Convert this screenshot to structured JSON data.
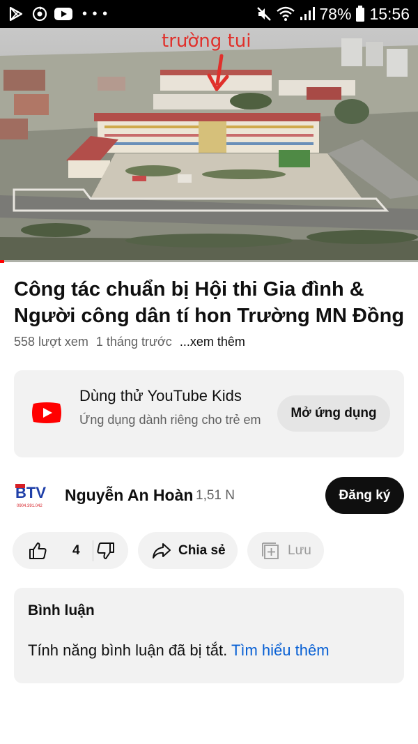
{
  "status_bar": {
    "battery": "78%",
    "time": "15:56",
    "left_icons": [
      "play-store-icon",
      "sync-icon",
      "youtube-icon",
      "more-dots-icon"
    ],
    "right_icons": [
      "mute-icon",
      "wifi-icon",
      "signal-icon",
      "battery-icon"
    ]
  },
  "video": {
    "overlay_text": "trường tui",
    "progress": 0.01
  },
  "title": {
    "line1": "Công tác chuẩn bị Hội thi Gia đình &",
    "line2": "Người công dân tí hon Trường MN Đồng ..."
  },
  "meta": {
    "views": "558 lượt xem",
    "age": "1 tháng trước",
    "more": "...xem thêm"
  },
  "kids_promo": {
    "title": "Dùng thử YouTube Kids",
    "subtitle": "Ứng dụng dành riêng cho trẻ em",
    "button": "Mở ứng dụng"
  },
  "channel": {
    "avatar_text": "BTV",
    "avatar_phone": "0904.391.042",
    "name": "Nguyễn An Hoàn",
    "subscribers": "1,51 N",
    "subscribe_label": "Đăng ký"
  },
  "actions": {
    "like_count": "4",
    "share_label": "Chia sẻ",
    "save_label": "Lưu"
  },
  "comments": {
    "title": "Bình luận",
    "text": "Tính năng bình luận đã bị tắt.",
    "link": "Tìm hiểu thêm"
  },
  "colors": {
    "accent_red": "#ff0000",
    "link_blue": "#065fd4",
    "chip_bg": "#f2f2f2",
    "text_secondary": "#606060"
  }
}
